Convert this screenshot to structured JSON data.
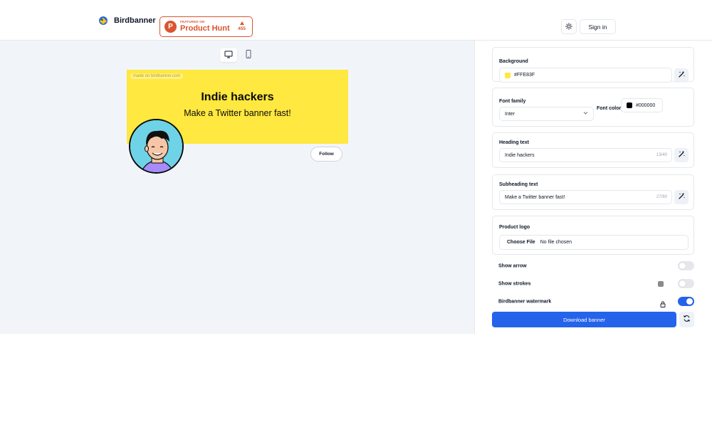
{
  "header": {
    "brand_name": "Birdbanner",
    "product_hunt": {
      "featured": "FEATURED ON",
      "name": "Product Hunt",
      "votes": "455"
    },
    "signin_label": "Sign in"
  },
  "preview": {
    "watermark": "made on birdbanner.com",
    "heading": "Indie hackers",
    "subheading": "Make a Twitter banner fast!",
    "follow_label": "Follow",
    "background_color": "#FFE83F"
  },
  "panel": {
    "background": {
      "label": "Background",
      "value": "#FFE83F"
    },
    "font_family": {
      "label": "Font family",
      "value": "Inter"
    },
    "font_color": {
      "label": "Font color",
      "value": "#000000"
    },
    "heading_text": {
      "label": "Heading text",
      "value": "Indie hackers",
      "counter": "13/40"
    },
    "subheading_text": {
      "label": "Subheading text",
      "value": "Make a Twitter banner fast!",
      "counter": "27/60"
    },
    "product_logo": {
      "label": "Product logo",
      "button": "Choose File",
      "status": "No file chosen"
    },
    "toggles": [
      {
        "label": "Show arrow",
        "on": false
      },
      {
        "label": "Show strokes",
        "on": false
      },
      {
        "label": "Birdbanner watermark",
        "on": true
      }
    ],
    "download_label": "Download banner"
  },
  "colors": {
    "accent": "#2563eb",
    "product_hunt": "#da552f",
    "banner": "#FFE83F"
  },
  "icons": [
    "brand-logo-icon",
    "sun-icon",
    "desktop-icon",
    "mobile-icon",
    "magic-wand-icon",
    "chevron-down-icon",
    "lock-icon",
    "refresh-icon"
  ]
}
